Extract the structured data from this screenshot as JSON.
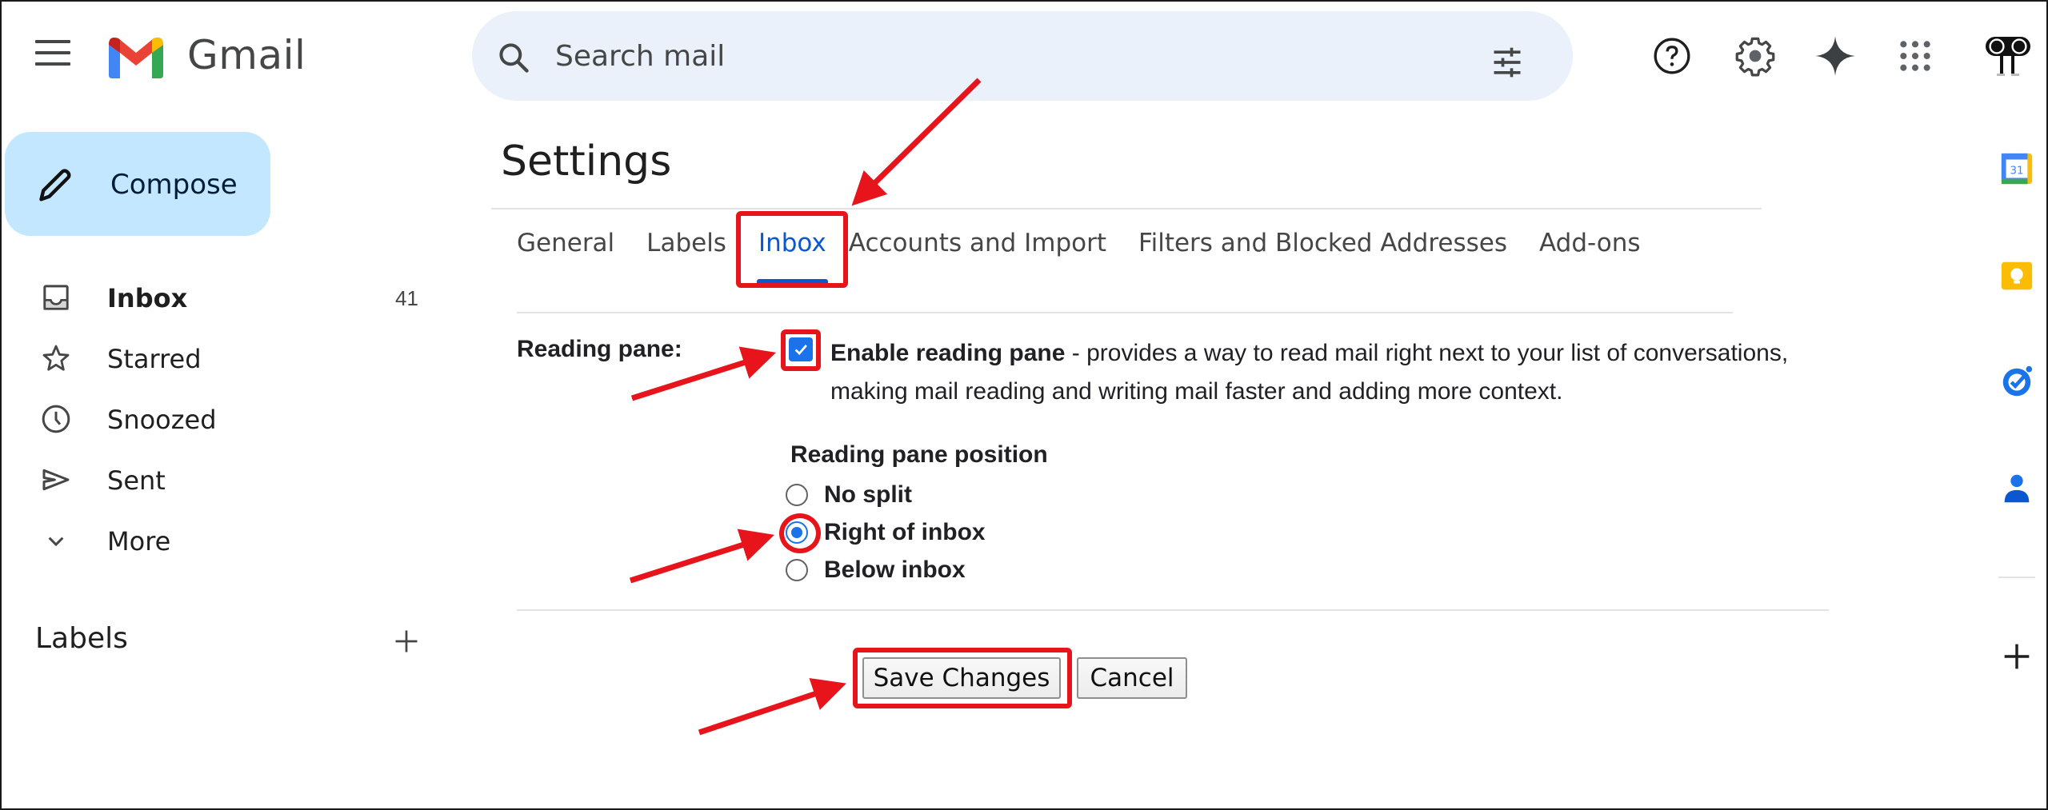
{
  "app": {
    "brand": "Gmail",
    "brand_colors": {
      "red": "#ea4335",
      "blue": "#4285f4",
      "green": "#34a853",
      "yellow": "#fbbc04",
      "dark_red": "#c5221f"
    }
  },
  "topbar": {
    "search_placeholder": "Search mail",
    "icons": [
      "menu-icon",
      "search-icon",
      "filter-sliders-icon",
      "help-icon",
      "settings-gear-icon",
      "gemini-sparkle-icon",
      "apps-grid-icon",
      "account-avatar"
    ]
  },
  "sidebar": {
    "compose_label": "Compose",
    "items": [
      {
        "label": "Inbox",
        "icon": "inbox-icon",
        "count": "41",
        "bold": true
      },
      {
        "label": "Starred",
        "icon": "star-icon"
      },
      {
        "label": "Snoozed",
        "icon": "clock-icon"
      },
      {
        "label": "Sent",
        "icon": "send-icon"
      },
      {
        "label": "More",
        "icon": "chevron-down-icon"
      }
    ],
    "labels_heading": "Labels"
  },
  "settings": {
    "title": "Settings",
    "tabs": [
      {
        "label": "General",
        "active": false
      },
      {
        "label": "Labels",
        "active": false
      },
      {
        "label": "Inbox",
        "active": true
      },
      {
        "label": "Accounts and Import",
        "active": false
      },
      {
        "label": "Filters and Blocked Addresses",
        "active": false
      },
      {
        "label": "Add-ons",
        "active": false
      }
    ],
    "reading_pane": {
      "label": "Reading pane:",
      "enable_checked": true,
      "enable_title": "Enable reading pane",
      "enable_desc": " - provides a way to read mail right next to your list of conversations, making mail reading and writing mail faster and adding more context.",
      "position_heading": "Reading pane position",
      "options": [
        {
          "label": "No split",
          "selected": false
        },
        {
          "label": "Right of inbox",
          "selected": true
        },
        {
          "label": "Below inbox",
          "selected": false
        }
      ]
    },
    "save_label": "Save Changes",
    "cancel_label": "Cancel"
  },
  "side_panel": {
    "apps": [
      "calendar-icon",
      "keep-icon",
      "tasks-icon",
      "contacts-icon"
    ],
    "calendar_day": "31",
    "add_label": "+"
  },
  "annotations": {
    "highlight_color": "#e8141b",
    "highlighted": [
      "Inbox tab",
      "Enable reading pane checkbox",
      "Right of inbox radio",
      "Save Changes button"
    ]
  }
}
